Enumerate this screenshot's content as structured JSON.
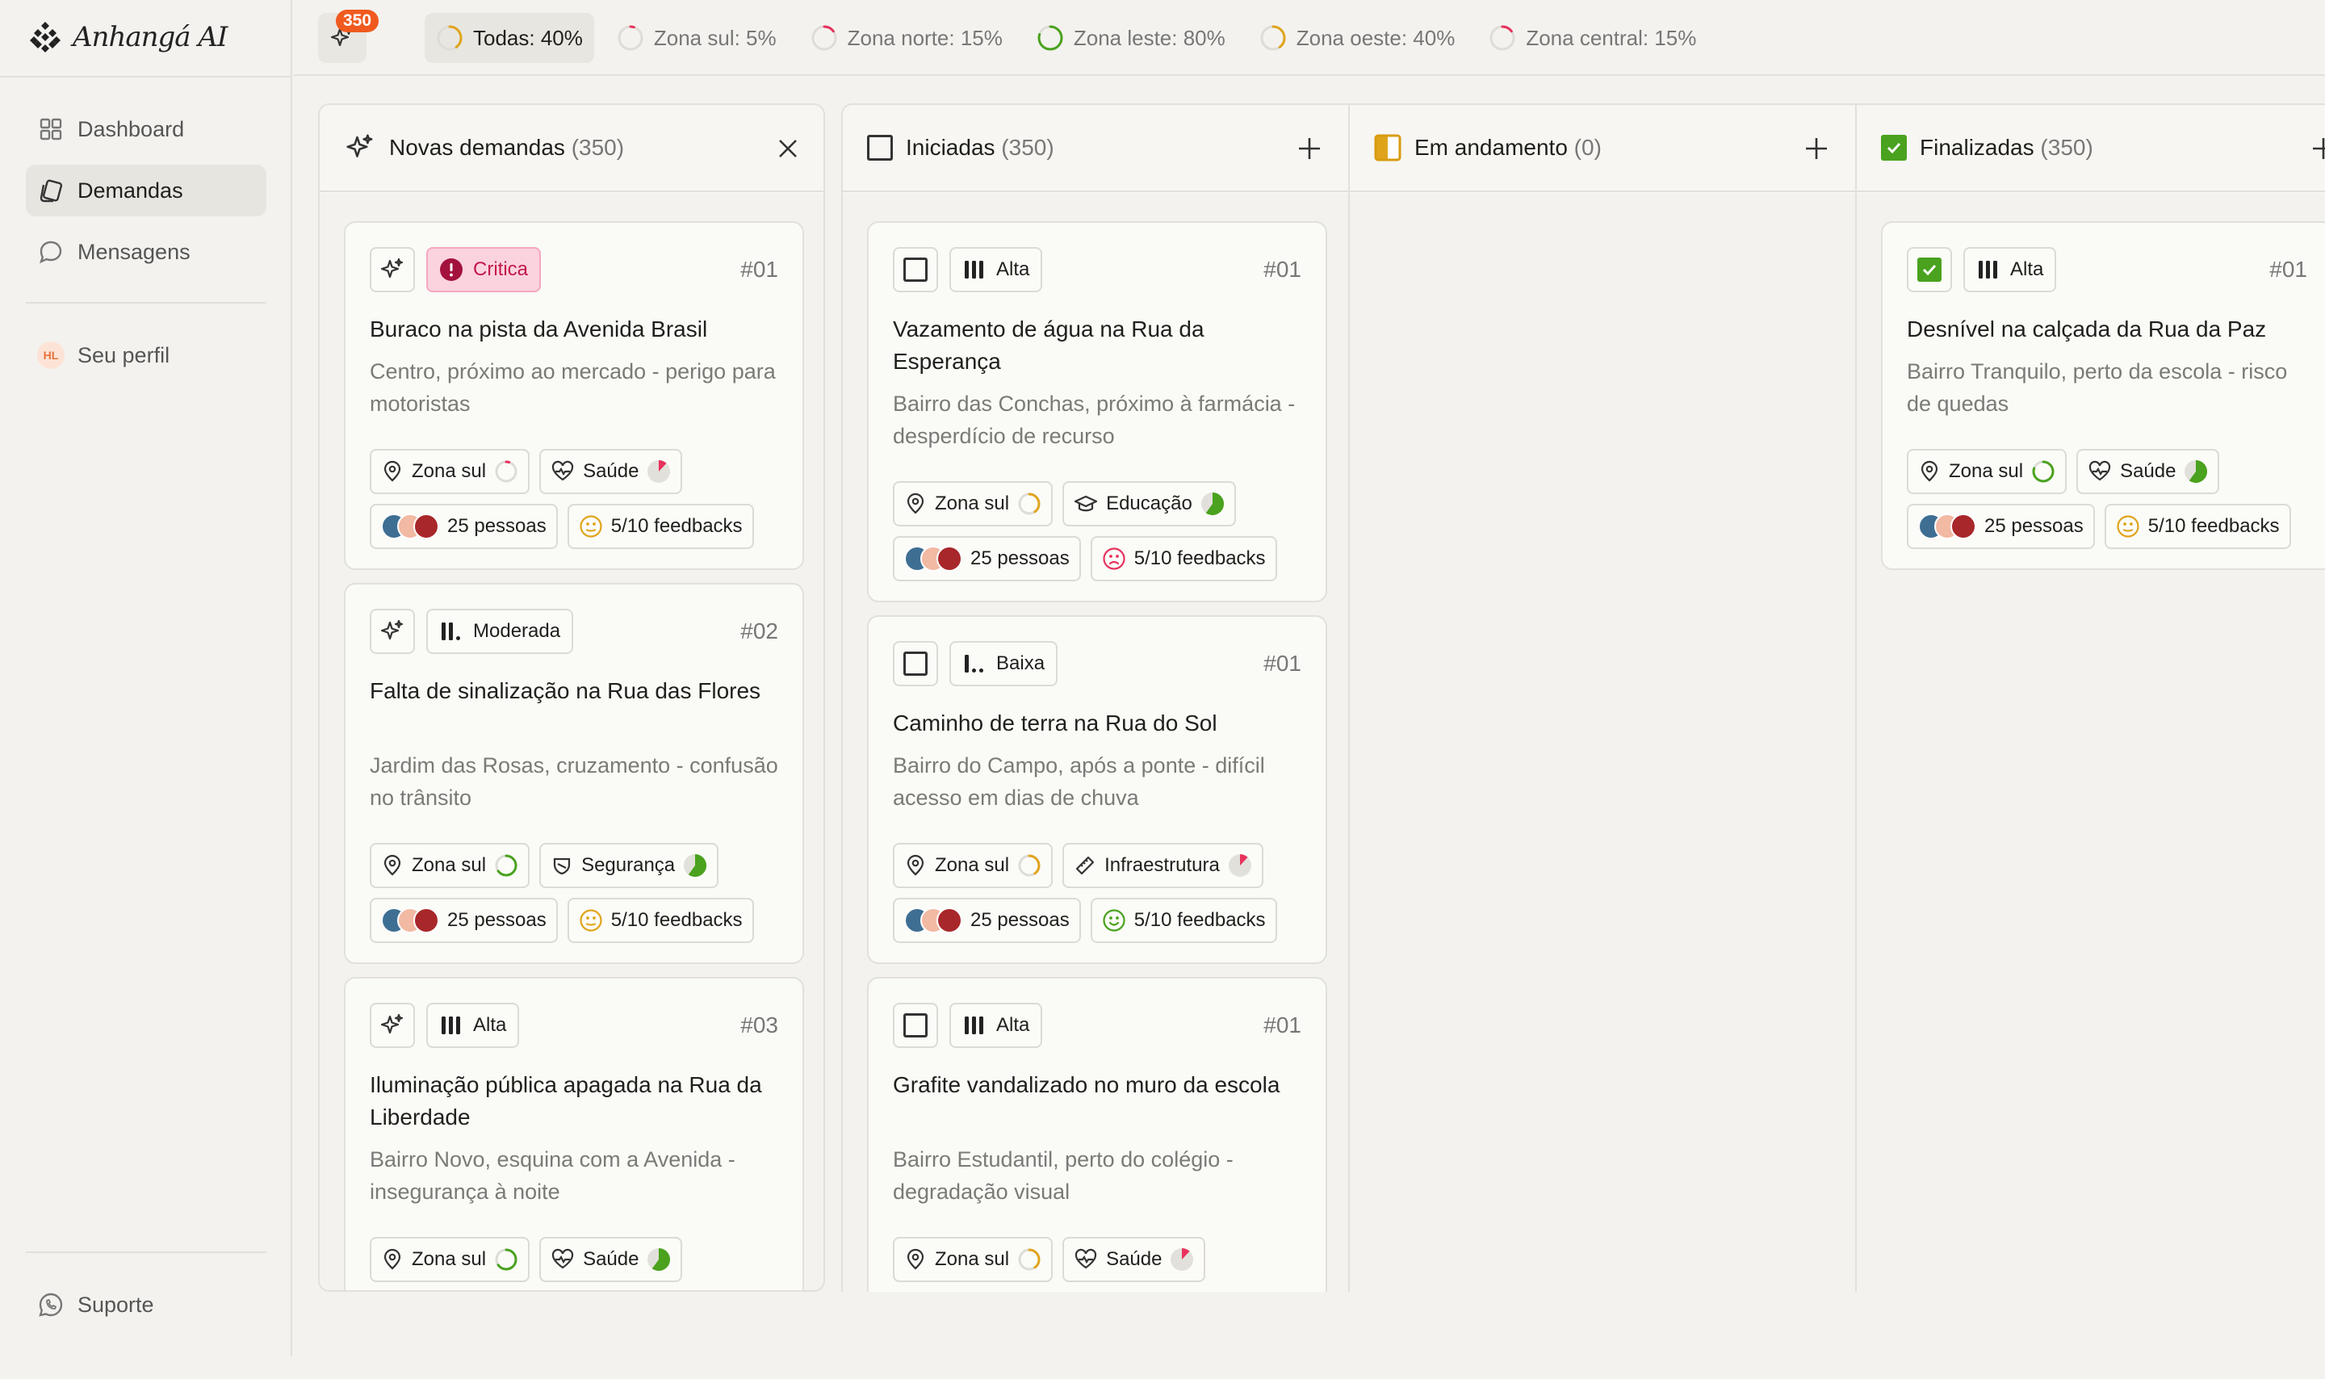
{
  "app": {
    "name": "Anhangá AI"
  },
  "sidebar": {
    "items": [
      {
        "label": "Dashboard",
        "icon": "grid-icon"
      },
      {
        "label": "Demandas",
        "icon": "cards-icon",
        "active": true
      },
      {
        "label": "Mensagens",
        "icon": "chat-bubble-icon"
      }
    ],
    "profile": {
      "initials": "HL",
      "label": "Seu perfil"
    },
    "support": {
      "label": "Suporte",
      "icon": "whatsapp-icon"
    }
  },
  "topbar": {
    "ai_badge": "350",
    "filters": [
      {
        "label": "Todas: 40%",
        "percent": 40,
        "color": "#e0a41c",
        "active": true
      },
      {
        "label": "Zona sul: 5%",
        "percent": 5,
        "color": "#e8325c"
      },
      {
        "label": "Zona norte: 15%",
        "percent": 15,
        "color": "#e8325c"
      },
      {
        "label": "Zona leste: 80%",
        "percent": 80,
        "color": "#4aa21e"
      },
      {
        "label": "Zona oeste: 40%",
        "percent": 40,
        "color": "#e0a41c"
      },
      {
        "label": "Zona central: 15%",
        "percent": 15,
        "color": "#e8325c"
      }
    ]
  },
  "columns": {
    "new": {
      "title": "Novas demandas",
      "count": "(350)",
      "cards": [
        {
          "priority": "Critica",
          "number": "#01",
          "title": "Buraco na pista da Avenida Brasil",
          "description": "Centro, próximo ao mercado - perigo para motoristas",
          "zone": "Zona sul",
          "category": "Saúde",
          "people": "25 pessoas",
          "feedback": "5/10 feedbacks"
        },
        {
          "priority": "Moderada",
          "number": "#02",
          "title": "Falta de sinalização na Rua das Flores",
          "description": "Jardim das Rosas, cruzamento - confusão no trânsito",
          "zone": "Zona sul",
          "category": "Segurança",
          "people": "25 pessoas",
          "feedback": "5/10 feedbacks"
        },
        {
          "priority": "Alta",
          "number": "#03",
          "title": "Iluminação pública apagada na Rua da Liberdade",
          "description": "Bairro Novo, esquina com a Avenida - insegurança à noite",
          "zone": "Zona sul",
          "category": "Saúde"
        }
      ]
    },
    "started": {
      "title": "Iniciadas",
      "count": "(350)",
      "cards": [
        {
          "priority": "Alta",
          "number": "#01",
          "title": "Vazamento de água na Rua da Esperança",
          "description": "Bairro das Conchas, próximo à farmácia - desperdício de recurso",
          "zone": "Zona sul",
          "category": "Educação",
          "people": "25 pessoas",
          "feedback": "5/10 feedbacks"
        },
        {
          "priority": "Baixa",
          "number": "#01",
          "title": "Caminho de terra na Rua do Sol",
          "description": "Bairro do Campo, após a ponte - difícil acesso em dias de chuva",
          "zone": "Zona sul",
          "category": "Infraestrutura",
          "people": "25 pessoas",
          "feedback": "5/10 feedbacks"
        },
        {
          "priority": "Alta",
          "number": "#01",
          "title": "Grafite vandalizado no muro da escola",
          "description": "Bairro Estudantil, perto do colégio - degradação visual",
          "zone": "Zona sul",
          "category": "Saúde"
        }
      ]
    },
    "in_progress": {
      "title": "Em andamento",
      "count": "(0)"
    },
    "done": {
      "title": "Finalizadas",
      "count": "(350)",
      "cards": [
        {
          "priority": "Alta",
          "number": "#01",
          "title": "Desnível na calçada da Rua da Paz",
          "description": "Bairro Tranquilo, perto da escola - risco de quedas",
          "zone": "Zona sul",
          "category": "Saúde",
          "people": "25 pessoas",
          "feedback": "5/10 feedbacks"
        }
      ]
    }
  }
}
